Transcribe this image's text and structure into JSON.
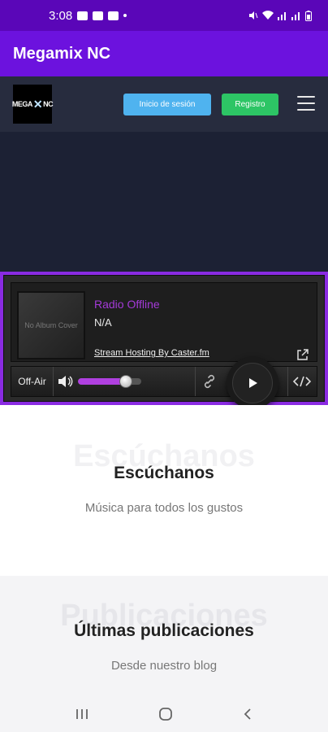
{
  "status": {
    "time": "3:08"
  },
  "app": {
    "title": "Megamix NC"
  },
  "nav": {
    "logo_text": "MEGAMIX NC",
    "login": "Inicio de sesión",
    "register": "Registro"
  },
  "player": {
    "cover_text": "No Album Cover",
    "title": "Radio Offline",
    "subtitle": "N/A",
    "hosting": "Stream Hosting By Caster.fm",
    "status": "Off-Air",
    "volume": 0.75
  },
  "section1": {
    "ghost": "Escúchanos",
    "title": "Escúchanos",
    "subtitle": "Música para todos los gustos"
  },
  "section2": {
    "ghost": "Publicaciones",
    "title": "Últimas publicaciones",
    "subtitle": "Desde nuestro blog"
  }
}
